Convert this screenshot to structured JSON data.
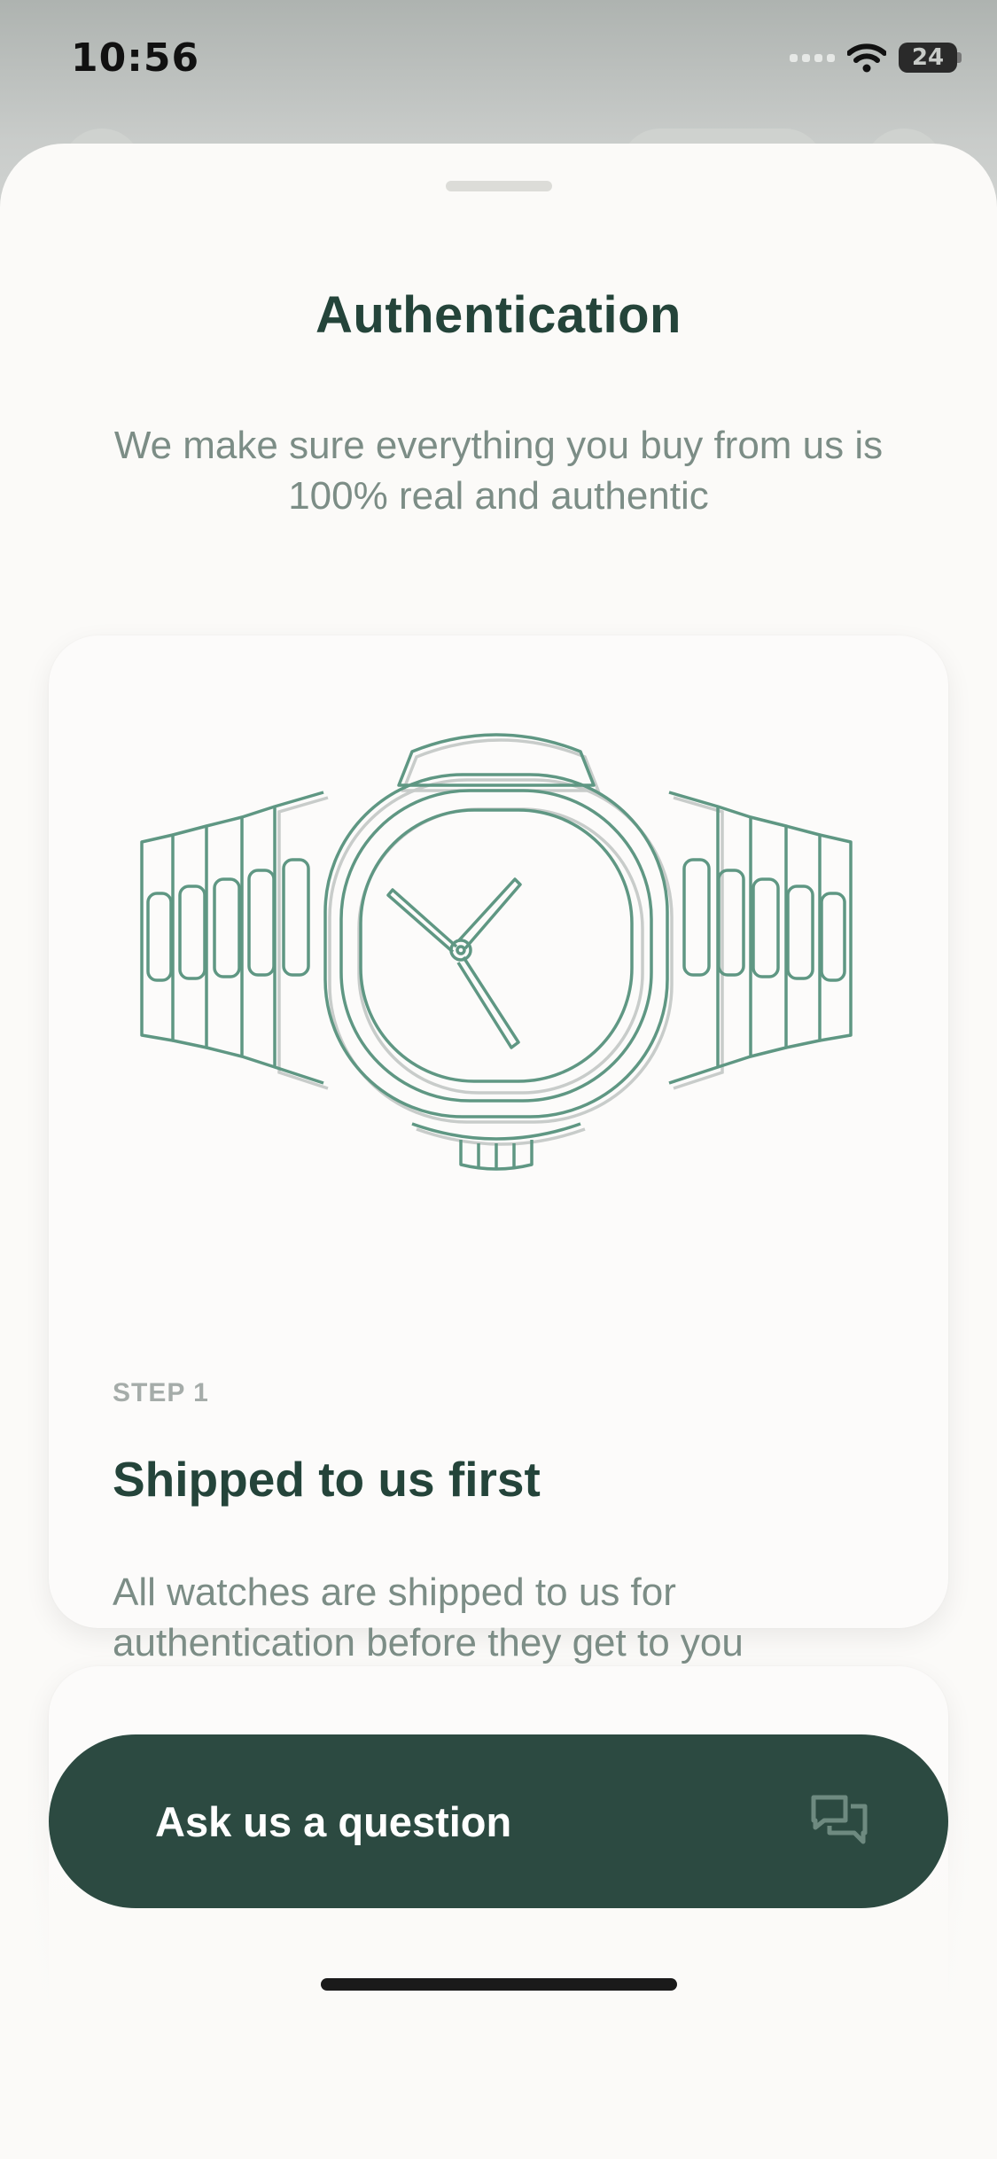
{
  "status_bar": {
    "time": "10:56",
    "battery_level": "24",
    "icons": [
      "signal-icon",
      "wifi-icon",
      "battery-icon"
    ]
  },
  "sheet": {
    "title": "Authentication",
    "subtitle": "We make sure everything you buy from us is 100% real and authentic"
  },
  "steps": [
    {
      "label": "STEP 1",
      "title": "Shipped to us first",
      "description": "All watches are shipped to us for authentication before they get to you",
      "illustration": "watch-illustration"
    }
  ],
  "cta": {
    "label": "Ask us a question",
    "icon": "chat-bubbles-icon"
  },
  "colors": {
    "primary": "#2c4a41",
    "heading": "#24443a",
    "body_text": "#7c8d86",
    "step_label": "#a5aca9",
    "illustration_line": "#5f9783",
    "sheet_bg": "#fbfaf8"
  }
}
